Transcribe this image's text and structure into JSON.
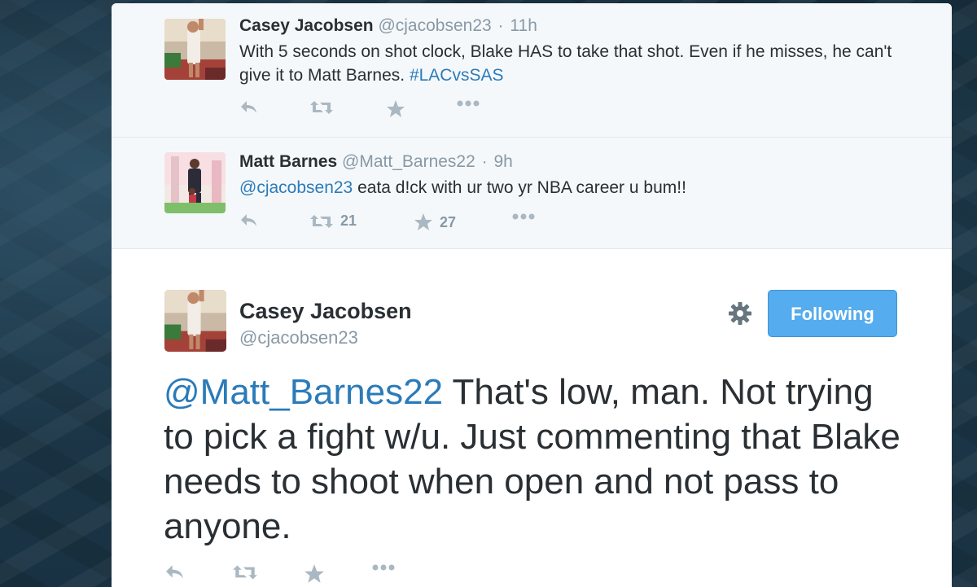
{
  "tweets": [
    {
      "name": "Casey Jacobsen",
      "handle": "@cjacobsen23",
      "separator": "·",
      "time": "11h",
      "text": "With 5 seconds on shot clock, Blake HAS to take that shot.  Even if he misses, he can't give it to Matt Barnes. ",
      "hashtag": "#LACvsSAS",
      "retweets": "",
      "favorites": ""
    },
    {
      "name": "Matt Barnes",
      "handle": "@Matt_Barnes22",
      "separator": "·",
      "time": "9h",
      "mention": "@cjacobsen23",
      "text": " eata d!ck with ur two yr NBA career u bum!!",
      "retweets": "21",
      "favorites": "27"
    }
  ],
  "main_tweet": {
    "name": "Casey Jacobsen",
    "handle": "@cjacobsen23",
    "follow_label": "Following",
    "mention": "@Matt_Barnes22",
    "text": " That's low, man. Not trying to pick a fight w/u.  Just commenting that Blake needs to shoot when open and not pass to anyone."
  },
  "colors": {
    "link": "#2b7bb9",
    "follow_button": "#55acee",
    "icon": "#aab8c2",
    "text": "#292f33",
    "muted": "#8899a6"
  },
  "icons": {
    "reply": "reply-icon",
    "retweet": "retweet-icon",
    "favorite": "star-icon",
    "more": "more-icon",
    "settings": "gear-icon"
  }
}
